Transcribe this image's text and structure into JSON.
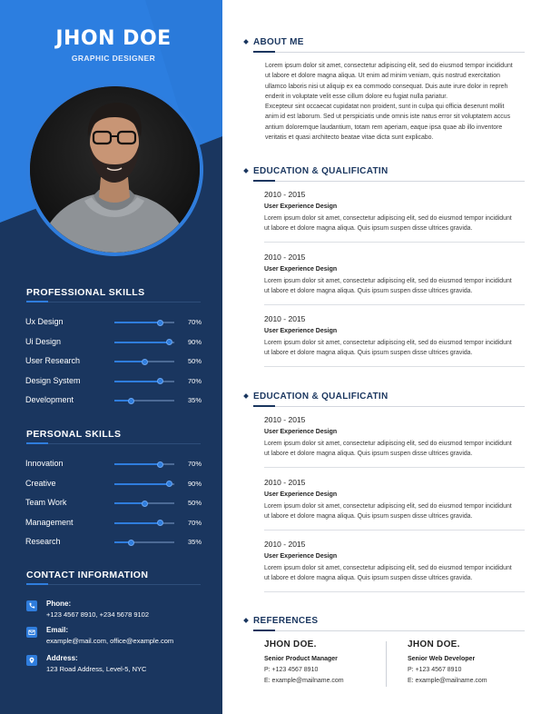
{
  "profile": {
    "name": "JHON DOE",
    "role": "GRAPHIC DESIGNER"
  },
  "colors": {
    "sidebar_dark": "#1a365f",
    "accent_blue": "#2f7ddd",
    "hero_blue": "#2c7ee0"
  },
  "professional_skills": {
    "title": "PROFESSIONAL SKILLS",
    "items": [
      {
        "label": "Ux Design",
        "percent": "70%",
        "level": 0.76
      },
      {
        "label": "Ui Design",
        "percent": "90%",
        "level": 0.92
      },
      {
        "label": "User Research",
        "percent": "50%",
        "level": 0.5
      },
      {
        "label": "Design System",
        "percent": "70%",
        "level": 0.76
      },
      {
        "label": "Development",
        "percent": "35%",
        "level": 0.28
      }
    ]
  },
  "personal_skills": {
    "title": "PERSONAL SKILLS",
    "items": [
      {
        "label": "Innovation",
        "percent": "70%",
        "level": 0.76
      },
      {
        "label": "Creative",
        "percent": "90%",
        "level": 0.92
      },
      {
        "label": "Team Work",
        "percent": "50%",
        "level": 0.5
      },
      {
        "label": "Management",
        "percent": "70%",
        "level": 0.76
      },
      {
        "label": "Research",
        "percent": "35%",
        "level": 0.28
      }
    ]
  },
  "contact": {
    "title": "CONTACT INFORMATION",
    "phone": {
      "label": "Phone:",
      "value": "+123 4567 8910,  +234 5678 9102",
      "icon": "phone-icon"
    },
    "email": {
      "label": "Email:",
      "value": "example@mail.com, office@example.com",
      "icon": "mail-icon"
    },
    "address": {
      "label": "Address:",
      "value": "123 Road Address, Level-5, NYC",
      "icon": "location-pin-icon"
    }
  },
  "about": {
    "title": "ABOUT ME",
    "lines": [
      "Lorem ipsum dolor sit amet, consectetur adipiscing elit, sed do eiusmod tempor incididunt",
      "ut labore et dolore magna aliqua. Ut enim ad minim veniam, quis nostrud exercitation",
      "ullamco laboris nisi ut aliquip ex ea commodo consequat. Duis aute irure dolor in repreh",
      "enderit in voluptate velit esse cillum dolore eu fugiat nulla pariatur.",
      "Excepteur sint occaecat cupidatat non proident, sunt in culpa qui officia deserunt mollit",
      "anim id est laborum. Sed ut perspiciatis unde omnis iste natus error sit voluptatem accus",
      "antium doloremque laudantium, totam rem aperiam, eaque ipsa quae ab illo inventore",
      "veritatis et quasi architecto beatae vitae dicta sunt explicabo."
    ]
  },
  "education_1": {
    "title": "EDUCATION & QUALIFICATIN",
    "entries": [
      {
        "years": "2010 - 2015",
        "degree": "User Experience Design",
        "line1": "Lorem ipsum dolor sit amet, consectetur adipiscing elit, sed do eiusmod tempor incididunt",
        "line2": "ut labore et dolore magna aliqua. Quis ipsum suspen disse ultrices gravida."
      },
      {
        "years": "2010 - 2015",
        "degree": "User Experience Design",
        "line1": "Lorem ipsum dolor sit amet, consectetur adipiscing elit, sed do eiusmod tempor incididunt",
        "line2": "ut labore et dolore magna aliqua. Quis ipsum suspen disse ultrices gravida."
      },
      {
        "years": "2010 - 2015",
        "degree": "User Experience Design",
        "line1": "Lorem ipsum dolor sit amet, consectetur adipiscing elit, sed do eiusmod tempor incididunt",
        "line2": "ut labore et dolore magna aliqua. Quis ipsum suspen disse ultrices gravida."
      }
    ]
  },
  "education_2": {
    "title": "EDUCATION & QUALIFICATIN",
    "entries": [
      {
        "years": "2010 - 2015",
        "degree": "User Experience Design",
        "line1": "Lorem ipsum dolor sit amet, consectetur adipiscing elit, sed do eiusmod tempor incididunt",
        "line2": "ut labore et dolore magna aliqua. Quis ipsum suspen disse ultrices gravida."
      },
      {
        "years": "2010 - 2015",
        "degree": "User Experience Design",
        "line1": "Lorem ipsum dolor sit amet, consectetur adipiscing elit, sed do eiusmod tempor incididunt",
        "line2": "ut labore et dolore magna aliqua. Quis ipsum suspen disse ultrices gravida."
      },
      {
        "years": "2010 - 2015",
        "degree": "User Experience Design",
        "line1": "Lorem ipsum dolor sit amet, consectetur adipiscing elit, sed do eiusmod tempor incididunt",
        "line2": "ut labore et dolore magna aliqua. Quis ipsum suspen disse ultrices gravida."
      }
    ]
  },
  "references": {
    "title": "REFERENCES",
    "items": [
      {
        "name": "JHON DOE.",
        "title": "Senior Product Manager",
        "phone": "P: +123 4567 8910",
        "email": "E: example@mailname.com"
      },
      {
        "name": "JHON DOE.",
        "title": "Senior Web Developer",
        "phone": "P: +123 4567 8910",
        "email": "E: example@mailname.com"
      }
    ]
  }
}
